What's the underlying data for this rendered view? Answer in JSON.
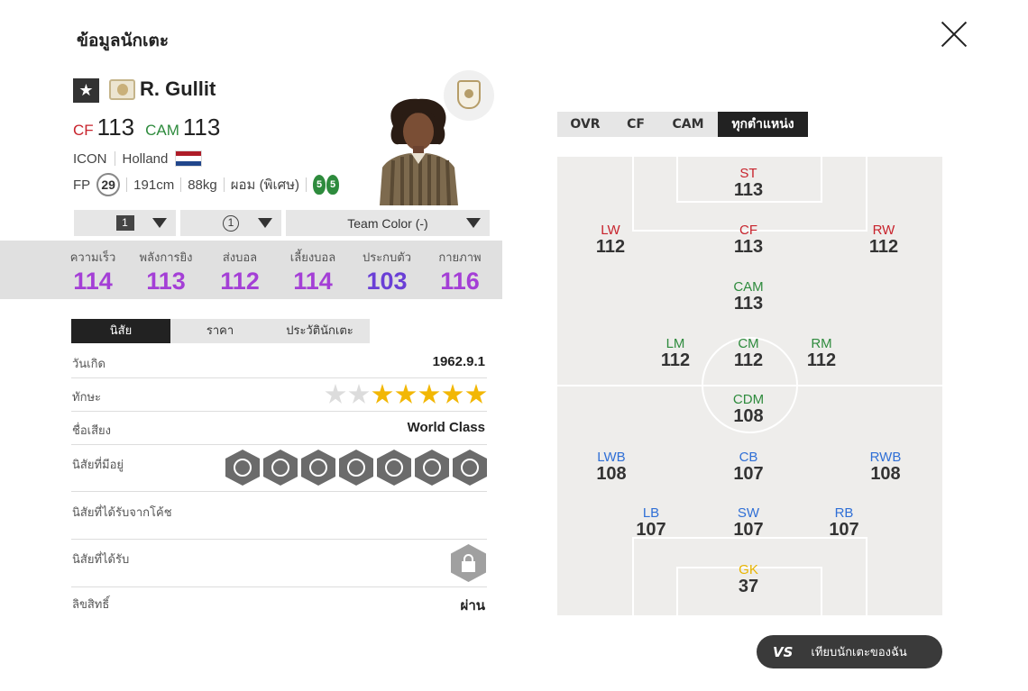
{
  "header": {
    "title": "ข้อมูลนักเตะ"
  },
  "player": {
    "name": "R. Gullit",
    "positions": [
      {
        "code": "CF",
        "value": "113",
        "color": "#c8232c"
      },
      {
        "code": "CAM",
        "value": "113",
        "color": "#2e8b3d"
      }
    ],
    "season": "ICON",
    "nation": "Holland",
    "nation_flag": [
      "#ae1c28",
      "#ffffff",
      "#21468b"
    ],
    "fp": "29",
    "height": "191cm",
    "weight": "88kg",
    "body_type": "ผอม (พิเศษ)",
    "left_foot": "5",
    "right_foot": "5"
  },
  "selectors": {
    "level": "1",
    "enhance": "1",
    "team_color": "Team Color (-)"
  },
  "stats": [
    {
      "label": "ความเร็ว",
      "value": "114",
      "color": "#a43fd6"
    },
    {
      "label": "พลังการยิง",
      "value": "113",
      "color": "#a43fd6"
    },
    {
      "label": "ส่งบอล",
      "value": "112",
      "color": "#a43fd6"
    },
    {
      "label": "เลี้ยงบอล",
      "value": "114",
      "color": "#a43fd6"
    },
    {
      "label": "ประกบตัว",
      "value": "103",
      "color": "#6a3fd6"
    },
    {
      "label": "กายภาพ",
      "value": "116",
      "color": "#a43fd6"
    }
  ],
  "tabs": [
    "นิสัย",
    "ราคา",
    "ประวัตินักเตะ"
  ],
  "info": {
    "birth_label": "วันเกิด",
    "birth_value": "1962.9.1",
    "skill_label": "ทักษะ",
    "skill_stars": 5,
    "skill_stars_total": 7,
    "reputation_label": "ชื่อเสียง",
    "reputation_value": "World Class",
    "traits_label": "นิสัยที่มีอยู่",
    "traits": [
      "header-icon",
      "long-shot-icon",
      "tackle-icon",
      "dribble-icon",
      "power-icon",
      "cross-icon",
      "playmaker-icon"
    ],
    "coach_traits_label": "นิสัยที่ได้รับจากโค้ช",
    "received_traits_label": "นิสัยที่ได้รับ",
    "license_label": "ลิขสิทธิ์",
    "license_value": "ผ่าน"
  },
  "position_tabs": [
    "OVR",
    "CF",
    "CAM",
    "ทุกตำแหน่ง"
  ],
  "position_grid": {
    "st": {
      "code": "ST",
      "value": "113",
      "color": "#c8232c"
    },
    "lw": {
      "code": "LW",
      "value": "112",
      "color": "#c8232c"
    },
    "cf": {
      "code": "CF",
      "value": "113",
      "color": "#c8232c"
    },
    "rw": {
      "code": "RW",
      "value": "112",
      "color": "#c8232c"
    },
    "cam": {
      "code": "CAM",
      "value": "113",
      "color": "#2e8b3d"
    },
    "lm": {
      "code": "LM",
      "value": "112",
      "color": "#2e8b3d"
    },
    "cm": {
      "code": "CM",
      "value": "112",
      "color": "#2e8b3d"
    },
    "rm": {
      "code": "RM",
      "value": "112",
      "color": "#2e8b3d"
    },
    "cdm": {
      "code": "CDM",
      "value": "108",
      "color": "#2e8b3d"
    },
    "lwb": {
      "code": "LWB",
      "value": "108",
      "color": "#2f6fd6"
    },
    "cb": {
      "code": "CB",
      "value": "107",
      "color": "#2f6fd6"
    },
    "rwb": {
      "code": "RWB",
      "value": "108",
      "color": "#2f6fd6"
    },
    "lb": {
      "code": "LB",
      "value": "107",
      "color": "#2f6fd6"
    },
    "sw": {
      "code": "SW",
      "value": "107",
      "color": "#2f6fd6"
    },
    "rb": {
      "code": "RB",
      "value": "107",
      "color": "#2f6fd6"
    },
    "gk": {
      "code": "GK",
      "value": "37",
      "color": "#e8b400"
    }
  },
  "compare": {
    "vs": "VS",
    "label": "เทียบนักเตะของฉัน"
  }
}
